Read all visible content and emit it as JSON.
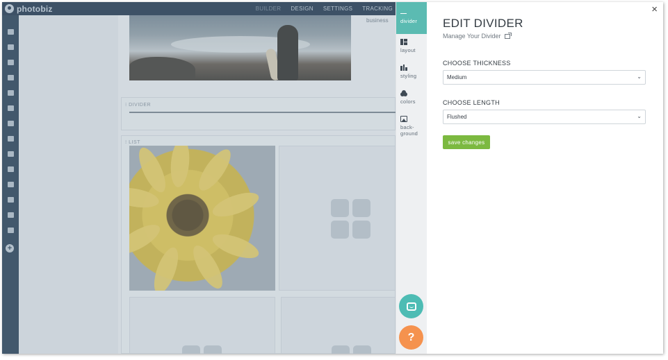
{
  "app": {
    "logo_text": "photobiz",
    "nav": [
      "BUILDER",
      "DESIGN",
      "SETTINGS",
      "TRACKING"
    ],
    "business_text": "business",
    "divider_label": "DIVIDER",
    "list_label": "LIST"
  },
  "tabs": [
    {
      "label": "divider",
      "icon": "minus-icon"
    },
    {
      "label": "layout",
      "icon": "layout-icon"
    },
    {
      "label": "styling",
      "icon": "styling-icon"
    },
    {
      "label": "colors",
      "icon": "colors-icon"
    },
    {
      "label": "back-\nground",
      "icon": "image-icon"
    }
  ],
  "modal": {
    "title": "EDIT DIVIDER",
    "subtitle": "Manage Your Divider",
    "close_glyph": "×",
    "thickness_label": "CHOOSE THICKNESS",
    "thickness_value": "Medium",
    "length_label": "CHOOSE LENGTH",
    "length_value": "Flushed",
    "save_label": "save changes"
  },
  "fab": {
    "help_glyph": "?"
  },
  "colors": {
    "accent_teal": "#5bbbb2",
    "save_green": "#7cb940",
    "help_orange": "#f5924e",
    "sidebar_navy": "#34495e"
  }
}
